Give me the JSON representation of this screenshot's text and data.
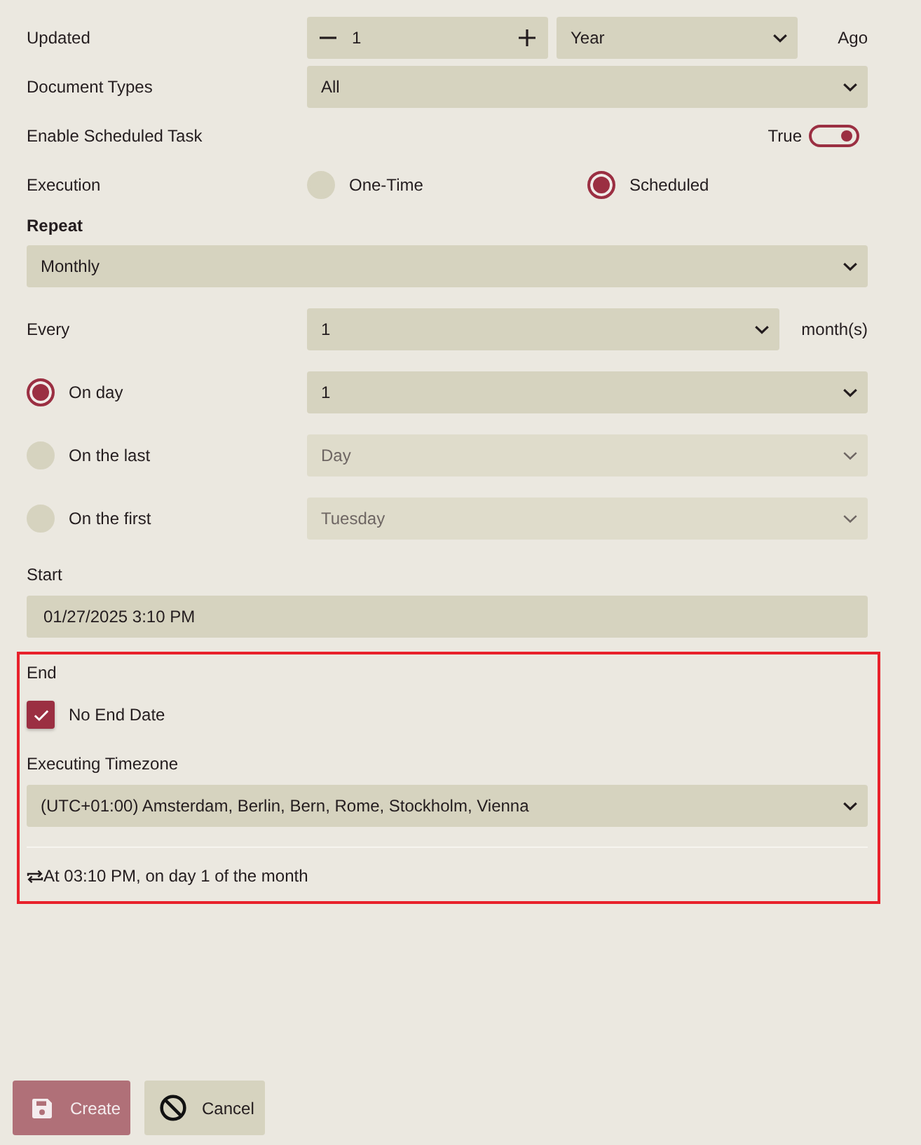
{
  "rows": [
    {
      "kind": "stepper",
      "label": "Updated",
      "value": "1",
      "unit": "Year",
      "suffix": "Ago"
    },
    {
      "kind": "select",
      "label": "Document Types",
      "value": "All"
    },
    {
      "kind": "toggle",
      "label": "Enable Scheduled Task",
      "state_text": "True",
      "on": true
    },
    {
      "kind": "radio",
      "label": "Execution",
      "options": [
        {
          "label": "One-Time",
          "selected": false
        },
        {
          "label": "Scheduled",
          "selected": true
        }
      ]
    }
  ],
  "repeat": {
    "label": "Repeat",
    "value": "Monthly"
  },
  "every": {
    "label": "Every",
    "value": "1",
    "suffix": "month(s)"
  },
  "day_options": [
    {
      "label": "On day",
      "selected": true,
      "value": "1",
      "disabled": false
    },
    {
      "label": "On the last",
      "selected": false,
      "value": "Day",
      "disabled": true
    },
    {
      "label": "On the first",
      "selected": false,
      "value": "Tuesday",
      "disabled": true
    }
  ],
  "start": {
    "label": "Start",
    "value": "01/27/2025 3:10 PM"
  },
  "end": {
    "label": "End",
    "no_end_date": {
      "label": "No End Date",
      "checked": true
    },
    "timezone": {
      "label": "Executing Timezone",
      "value": "(UTC+01:00) Amsterdam, Berlin, Bern, Rome, Stockholm, Vienna"
    },
    "summary": "At 03:10 PM, on day 1 of the month"
  },
  "buttons": [
    {
      "kind": "create",
      "label": "Create",
      "disabled": true
    },
    {
      "kind": "cancel",
      "label": "Cancel",
      "disabled": false
    }
  ]
}
